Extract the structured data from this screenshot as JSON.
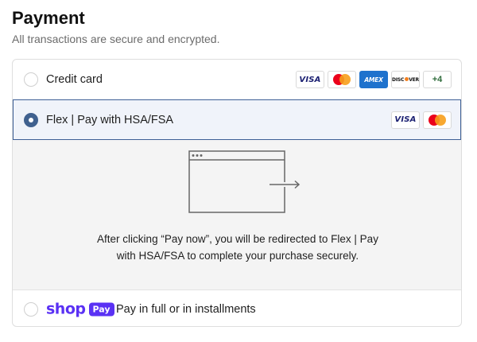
{
  "heading": {
    "title": "Payment",
    "subtitle": "All transactions are secure and encrypted."
  },
  "options": {
    "credit_card": {
      "label": "Credit card",
      "selected": false,
      "cards": [
        "VISA",
        "MASTERCARD",
        "AMEX",
        "DISCOVER",
        "+4"
      ],
      "amex_text": "AMEX",
      "discover_text_a": "DISC",
      "discover_text_b": "VER",
      "more_text": "+4"
    },
    "flex": {
      "label": "Flex | Pay with HSA/FSA",
      "selected": true,
      "cards": [
        "VISA",
        "MASTERCARD"
      ],
      "redirect_text": "After clicking “Pay now”, you will be redirected to Flex | Pay with HSA/FSA to complete your purchase securely."
    },
    "shop_pay": {
      "logo_word": "shop",
      "logo_badge": "Pay",
      "label": "Pay in full or in installments",
      "selected": false
    }
  },
  "visa_text": "VISA",
  "colors": {
    "selected_radio": "#40618f",
    "selected_row_bg": "#f0f3fa",
    "shop_purple": "#5a31f4",
    "panel_bg": "#f4f4f4"
  }
}
